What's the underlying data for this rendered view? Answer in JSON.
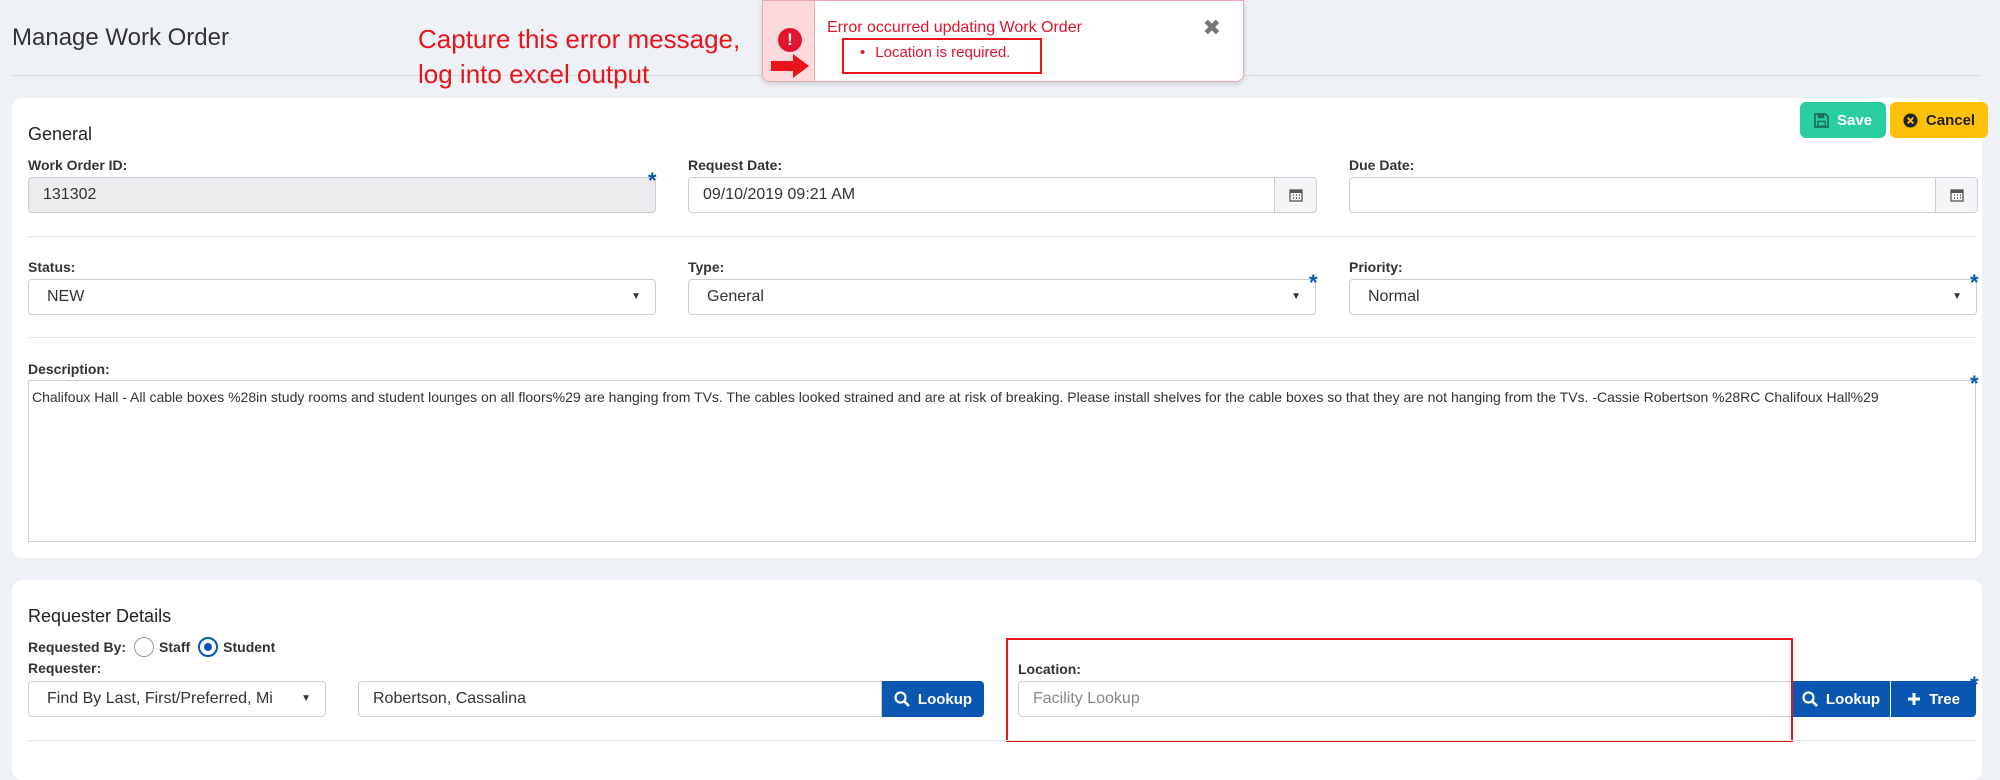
{
  "page": {
    "title": "Manage Work Order"
  },
  "annotation": {
    "text": "Capture this error message,\nlog into excel output"
  },
  "toast": {
    "title": "Error occurred updating Work Order",
    "message": "Location is required.",
    "close_symbol": "✖"
  },
  "toolbar": {
    "save_label": "Save",
    "cancel_label": "Cancel"
  },
  "general": {
    "section_title": "General",
    "work_order_id": {
      "label": "Work Order ID:",
      "value": "131302"
    },
    "request_date": {
      "label": "Request Date:",
      "value": "09/10/2019 09:21 AM"
    },
    "due_date": {
      "label": "Due Date:",
      "value": ""
    },
    "status": {
      "label": "Status:",
      "value": "NEW"
    },
    "type": {
      "label": "Type:",
      "value": "General"
    },
    "priority": {
      "label": "Priority:",
      "value": "Normal"
    },
    "description": {
      "label": "Description:",
      "value": "Chalifoux Hall - All cable boxes %28in study rooms and student lounges on all floors%29 are hanging from TVs. The cables looked strained and are at risk of breaking. Please install shelves for the cable boxes so that they are not hanging from the TVs. -Cassie Robertson %28RC Chalifoux Hall%29"
    },
    "required_star": "*"
  },
  "requester": {
    "section_title": "Requester Details",
    "requested_by_label": "Requested By:",
    "staff_label": "Staff",
    "student_label": "Student",
    "selected": "Student",
    "requester_label": "Requester:",
    "find_by_value": "Find By Last, First/Preferred, Mi",
    "requester_name": "Robertson, Cassalina",
    "lookup_label": "Lookup",
    "location_label": "Location:",
    "location_placeholder": "Facility Lookup",
    "location_lookup_label": "Lookup",
    "tree_label": "Tree"
  },
  "colors": {
    "accent": "#0a56b0",
    "error": "#e3142d",
    "save": "#2bcea1",
    "cancel": "#ffc107"
  },
  "icons": [
    "alert-icon",
    "arrow-right-icon",
    "close-icon",
    "save-icon",
    "cancel-icon",
    "calendar-icon",
    "search-icon",
    "plus-icon",
    "chevron-down-icon"
  ]
}
